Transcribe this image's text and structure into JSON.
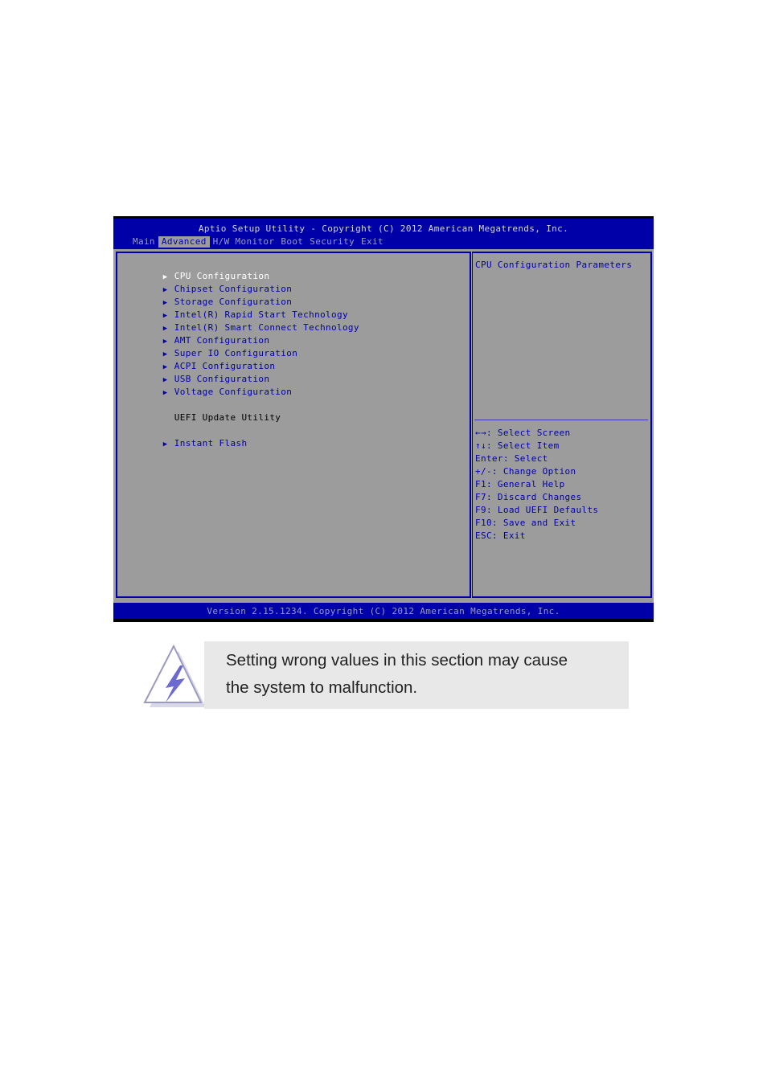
{
  "bios": {
    "title": "Aptio Setup Utility - Copyright (C) 2012 American Megatrends, Inc.",
    "tabs": [
      {
        "label": "Main",
        "active": false
      },
      {
        "label": "Advanced",
        "active": true
      },
      {
        "label": "H/W Monitor",
        "active": false
      },
      {
        "label": "Boot",
        "active": false
      },
      {
        "label": "Security",
        "active": false
      },
      {
        "label": "Exit",
        "active": false
      }
    ],
    "menu": [
      {
        "label": "CPU Configuration",
        "submenu": true,
        "selected": true
      },
      {
        "label": "Chipset Configuration",
        "submenu": true
      },
      {
        "label": "Storage Configuration",
        "submenu": true
      },
      {
        "label": "Intel(R) Rapid Start Technology",
        "submenu": true
      },
      {
        "label": "Intel(R) Smart Connect Technology",
        "submenu": true
      },
      {
        "label": "AMT Configuration",
        "submenu": true
      },
      {
        "label": "Super IO Configuration",
        "submenu": true
      },
      {
        "label": "ACPI Configuration",
        "submenu": true
      },
      {
        "label": "USB Configuration",
        "submenu": true
      },
      {
        "label": "Voltage Configuration",
        "submenu": true
      },
      {
        "label": "UEFI Update Utility",
        "submenu": false
      },
      {
        "label": "Instant Flash",
        "submenu": true
      }
    ],
    "help": "CPU Configuration Parameters",
    "keys": [
      "←→: Select Screen",
      "↑↓: Select Item",
      "Enter: Select",
      "+/-: Change Option",
      "F1: General Help",
      "F7: Discard Changes",
      "F9: Load UEFI Defaults",
      "F10: Save and Exit",
      "ESC: Exit"
    ],
    "footer": "Version 2.15.1234. Copyright (C) 2012 American Megatrends, Inc.",
    "submenu_arrow": "▶"
  },
  "warning": {
    "icon": "warning-lightning-icon",
    "text_line1": "Setting wrong values in this section may cause",
    "text_line2": "the system to malfunction."
  }
}
